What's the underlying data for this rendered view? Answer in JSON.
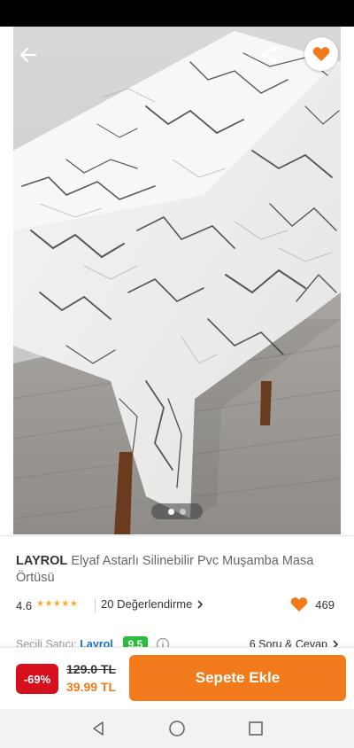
{
  "product": {
    "brand": "LAYROL",
    "name": "Elyaf Astarlı Silinebilir Pvc Muşamba Masa Örtüsü",
    "image_count": 2,
    "image_active_index": 0
  },
  "rating": {
    "value": "4.6",
    "stars": "★★★★★",
    "review_link": "20 Değerlendirme",
    "favorite_count": "469"
  },
  "seller": {
    "label": "Seçili Satıcı:",
    "name": "Layrol",
    "score": "9.5",
    "qa_link": "6 Soru & Cevap"
  },
  "price": {
    "discount": "-69%",
    "old": "129.0 TL",
    "new": "39.99 TL"
  },
  "actions": {
    "add_to_cart": "Sepete Ekle"
  },
  "icons": {
    "back": "arrow-left-icon",
    "share": "share-icon",
    "favorite": "heart-icon",
    "nav_back": "triangle-back-icon",
    "nav_home": "circle-home-icon",
    "nav_recent": "square-recent-icon"
  },
  "colors": {
    "accent": "#f27a1a",
    "discount": "#d6111d",
    "seller_link": "#1b72d3",
    "seller_score": "#2cbf3f",
    "stars": "#ffa91f"
  }
}
